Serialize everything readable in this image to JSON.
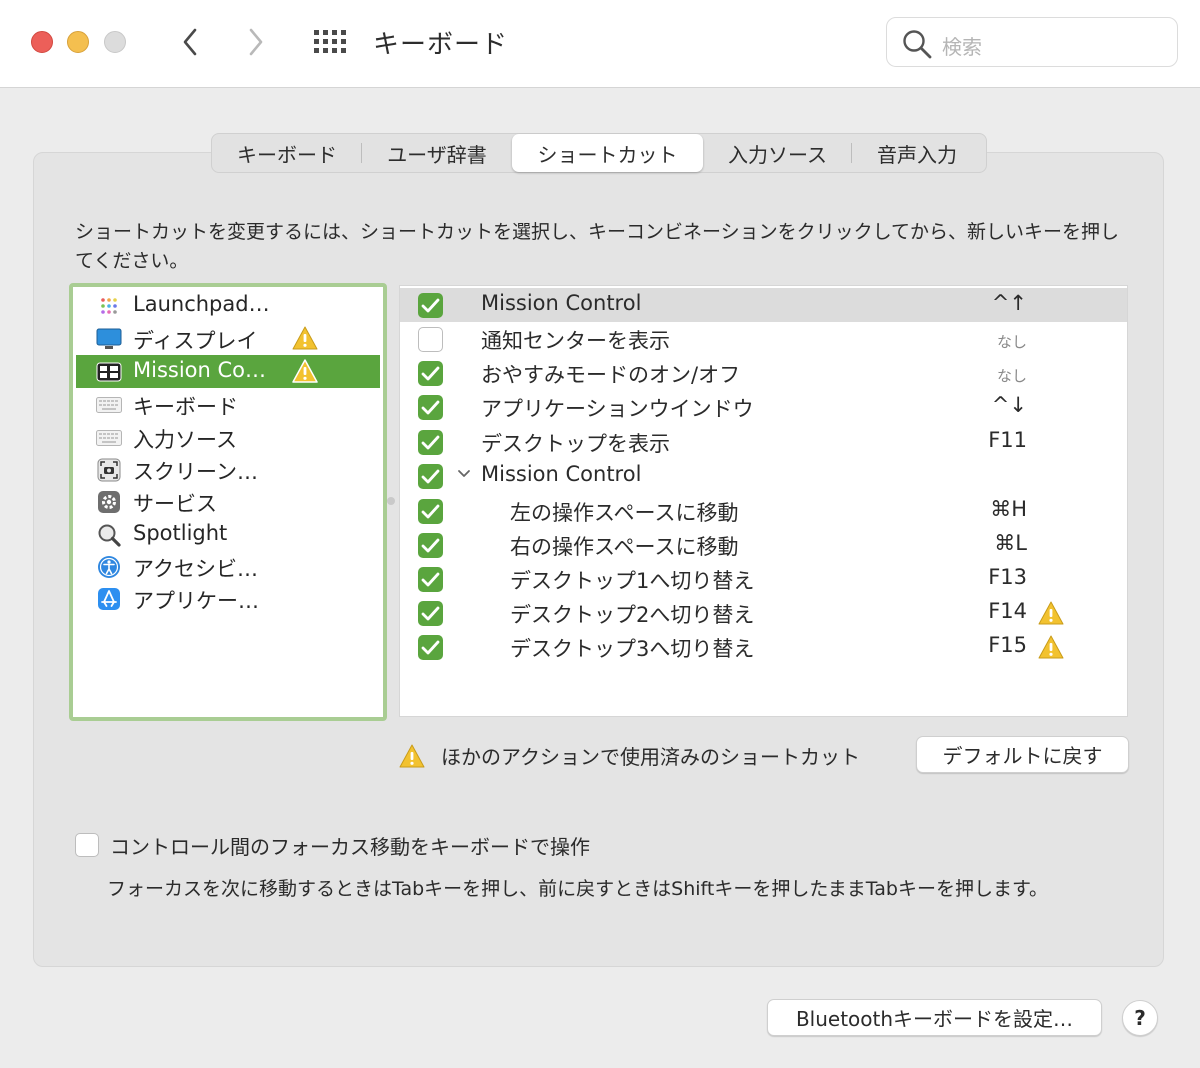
{
  "window": {
    "title": "キーボード"
  },
  "search": {
    "placeholder": "検索"
  },
  "tabs": [
    {
      "label": "キーボード"
    },
    {
      "label": "ユーザ辞書"
    },
    {
      "label": "ショートカット",
      "active": true
    },
    {
      "label": "入力ソース"
    },
    {
      "label": "音声入力"
    }
  ],
  "instructions": "ショートカットを変更するには、ショートカットを選択し、キーコンビネーションをクリックしてから、新しいキーを押してください。",
  "categories": [
    {
      "label": "Launchpad…",
      "icon": "launchpad-icon"
    },
    {
      "label": "ディスプレイ",
      "icon": "display-icon",
      "warning": true
    },
    {
      "label": "Mission Co…",
      "icon": "mission-control-icon",
      "warning": true,
      "selected": true
    },
    {
      "label": "キーボード",
      "icon": "keyboard-icon"
    },
    {
      "label": "入力ソース",
      "icon": "input-source-icon"
    },
    {
      "label": "スクリーン…",
      "icon": "screenshot-icon"
    },
    {
      "label": "サービス",
      "icon": "services-icon"
    },
    {
      "label": "Spotlight",
      "icon": "spotlight-icon"
    },
    {
      "label": "アクセシビ…",
      "icon": "accessibility-icon"
    },
    {
      "label": "アプリケー…",
      "icon": "app-shortcuts-icon"
    }
  ],
  "shortcuts": [
    {
      "name": "Mission Control",
      "key": "^↑",
      "checked": true,
      "selected": true,
      "indent": 0
    },
    {
      "name": "通知センターを表示",
      "key": "なし",
      "checked": false,
      "indent": 0
    },
    {
      "name": "おやすみモードのオン/オフ",
      "key": "なし",
      "checked": true,
      "indent": 0
    },
    {
      "name": "アプリケーションウインドウ",
      "key": "^↓",
      "checked": true,
      "indent": 0
    },
    {
      "name": "デスクトップを表示",
      "key": "F11",
      "checked": true,
      "indent": 0
    },
    {
      "name": "Mission Control",
      "key": "",
      "checked": true,
      "indent": 0,
      "expandable": true
    },
    {
      "name": "左の操作スペースに移動",
      "key": "⌘H",
      "checked": true,
      "indent": 1
    },
    {
      "name": "右の操作スペースに移動",
      "key": "⌘L",
      "checked": true,
      "indent": 1
    },
    {
      "name": "デスクトップ1へ切り替え",
      "key": "F13",
      "checked": true,
      "indent": 1
    },
    {
      "name": "デスクトップ2へ切り替え",
      "key": "F14",
      "checked": true,
      "indent": 1,
      "warning": true
    },
    {
      "name": "デスクトップ3へ切り替え",
      "key": "F15",
      "checked": true,
      "indent": 1,
      "warning": true
    }
  ],
  "legend": "ほかのアクションで使用済みのショートカット",
  "default_button": "デフォルトに戻す",
  "focus": {
    "checked": false,
    "label": "コントロール間のフォーカス移動をキーボードで操作",
    "help": "フォーカスを次に移動するときはTabキーを押し、前に戻すときはShiftキーを押したままTabキーを押します。"
  },
  "bluetooth_button": "Bluetoothキーボードを設定…",
  "help_button": "?",
  "colors": {
    "accent_green": "#5aa53e",
    "warning_yellow": "#f2c230"
  }
}
